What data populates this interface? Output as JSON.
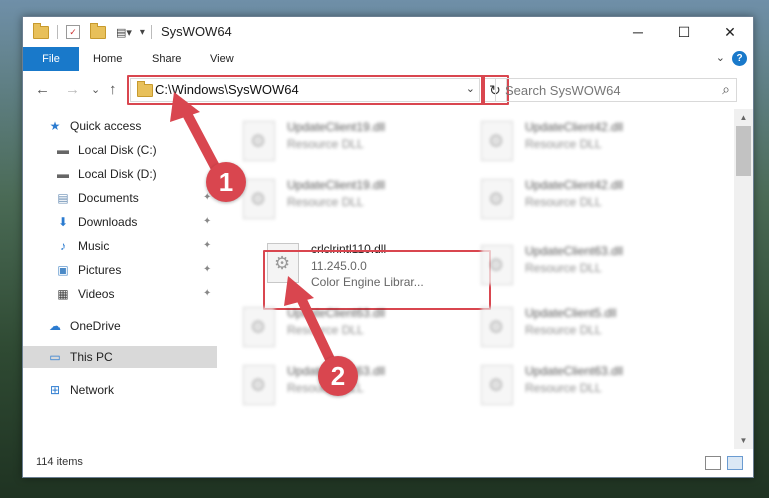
{
  "window": {
    "title": "SysWOW64",
    "minimize_glyph": "─",
    "maximize_glyph": "☐",
    "close_glyph": "✕"
  },
  "ribbon": {
    "tabs": [
      "File",
      "Home",
      "Share",
      "View"
    ],
    "help_glyph": "?",
    "expand_glyph": "⌄"
  },
  "nav": {
    "back_glyph": "←",
    "forward_glyph": "→",
    "recent_glyph": "⌄",
    "up_glyph": "↑",
    "address": "C:\\Windows\\SysWOW64",
    "address_dropdown_glyph": "⌄",
    "refresh_glyph": "↻",
    "search_placeholder": "Search SysWOW64",
    "search_glyph": "⌕"
  },
  "sidebar": {
    "items": [
      {
        "label": "Quick access",
        "icon": "star-icon"
      },
      {
        "label": "Local Disk (C:)",
        "icon": "drive-icon"
      },
      {
        "label": "Local Disk (D:)",
        "icon": "drive-icon"
      },
      {
        "label": "Documents",
        "icon": "documents-icon"
      },
      {
        "label": "Downloads",
        "icon": "downloads-icon"
      },
      {
        "label": "Music",
        "icon": "music-icon"
      },
      {
        "label": "Pictures",
        "icon": "pictures-icon"
      },
      {
        "label": "Videos",
        "icon": "videos-icon"
      },
      {
        "label": "OneDrive",
        "icon": "cloud-icon"
      },
      {
        "label": "This PC",
        "icon": "computer-icon"
      },
      {
        "label": "Network",
        "icon": "network-icon"
      }
    ],
    "pin_glyph": "📌"
  },
  "files": {
    "highlighted": {
      "name": "crlclrintl110.dll",
      "version": "11.245.0.0",
      "description": "Color Engine Librar..."
    },
    "background": [
      {
        "name": "UpdateClient19.dll",
        "type": "Resource DLL"
      },
      {
        "name": "UpdateClient42.dll",
        "type": "Resource DLL"
      },
      {
        "name": "UpdateClient19.dll",
        "type": "Resource DLL"
      },
      {
        "name": "UpdateClient42.dll",
        "type": "Resource DLL"
      },
      {
        "name": "UpdateClient63.dll",
        "type": "Resource DLL"
      },
      {
        "name": "UpdateClient63.dll",
        "type": "Resource DLL"
      },
      {
        "name": "UpdateClient5.dll",
        "type": "Resource DLL"
      },
      {
        "name": "UpdateClient63.dll",
        "type": "Resource DLL"
      },
      {
        "name": "UpdateClient63.dll",
        "type": "Resource DLL"
      }
    ]
  },
  "status": {
    "items_count": "114 items"
  },
  "annotations": {
    "step1": "1",
    "step2": "2",
    "accent_color": "#d9464f"
  },
  "colors": {
    "file_tab": "#1979ca",
    "highlight": "#d9464f",
    "selected_nav": "#d9d9d9"
  }
}
